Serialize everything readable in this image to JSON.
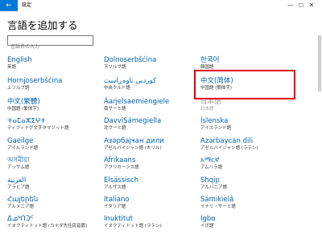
{
  "window": {
    "title": "設定",
    "back_icon": "back-arrow-icon",
    "min_glyph": "—",
    "max_glyph": "☐",
    "close_glyph": "✕"
  },
  "page": {
    "title": "言語を追加する"
  },
  "search": {
    "placeholder": "言語名の入力"
  },
  "languages": [
    {
      "name": "English",
      "sub": "英語",
      "enabled": true
    },
    {
      "name": "Dolnoserbšćina",
      "sub": "下ソルブ語",
      "enabled": true
    },
    {
      "name": "한국어",
      "sub": "韓国語",
      "enabled": true
    },
    {
      "name": "Hornjoserbšćina",
      "sub": "上ソルブ語",
      "enabled": true
    },
    {
      "name": "کوردیی ناوەڕاست",
      "sub": "中央クルド語",
      "enabled": true
    },
    {
      "name": "中文(简体)",
      "sub": "中国語 (簡体字)",
      "enabled": true
    },
    {
      "name": "中文(繁體)",
      "sub": "中国語 (繁体字)",
      "enabled": true
    },
    {
      "name": "Áarjelsaemiengiele",
      "sub": "南サーミ語",
      "enabled": true
    },
    {
      "name": "日本語",
      "sub": "日本語",
      "enabled": false
    },
    {
      "name": "ⵜⴰⵎⴰⵣⵉⵖⵜ",
      "sub": "ティフィナグ文字タマジット語",
      "enabled": true
    },
    {
      "name": "DavviSámegiella",
      "sub": "北サーミ語",
      "enabled": true
    },
    {
      "name": "Íslenska",
      "sub": "アイスランド語",
      "enabled": true
    },
    {
      "name": "Gaeilge",
      "sub": "アイルランド語",
      "enabled": true
    },
    {
      "name": "Азәрбајҹан дили",
      "sub": "アゼルバイジャン語 (キリル)",
      "enabled": true
    },
    {
      "name": "Azərbaycan dili",
      "sub": "アゼルバイジャン語 (ラテン)",
      "enabled": true
    },
    {
      "name": "অসমীয়া",
      "sub": "アッサム語",
      "enabled": true
    },
    {
      "name": "Afrikaans",
      "sub": "アフリカーンス語",
      "enabled": true
    },
    {
      "name": "አማርኛ",
      "sub": "アムハラ語",
      "enabled": true
    },
    {
      "name": "العربية",
      "sub": "アラビア語",
      "enabled": true
    },
    {
      "name": "Elsässisch",
      "sub": "アルザス語",
      "enabled": true
    },
    {
      "name": "Shqip",
      "sub": "アルバニア語",
      "enabled": true
    },
    {
      "name": "Հայերեն",
      "sub": "アルメニア語",
      "enabled": true
    },
    {
      "name": "Italiano",
      "sub": "イタリア語",
      "enabled": true
    },
    {
      "name": "Sámikielâ",
      "sub": "イナリ・サーミ語",
      "enabled": true
    },
    {
      "name": "ᐃᓄᒃᑎᑐᑦ",
      "sub": "イヌクティトット語 (カナダ先住民音節)",
      "enabled": true
    },
    {
      "name": "Inuktitut",
      "sub": "イヌクティトット語 (ラテン)",
      "enabled": true
    },
    {
      "name": "Igbo",
      "sub": "イボ語",
      "enabled": true
    }
  ]
}
